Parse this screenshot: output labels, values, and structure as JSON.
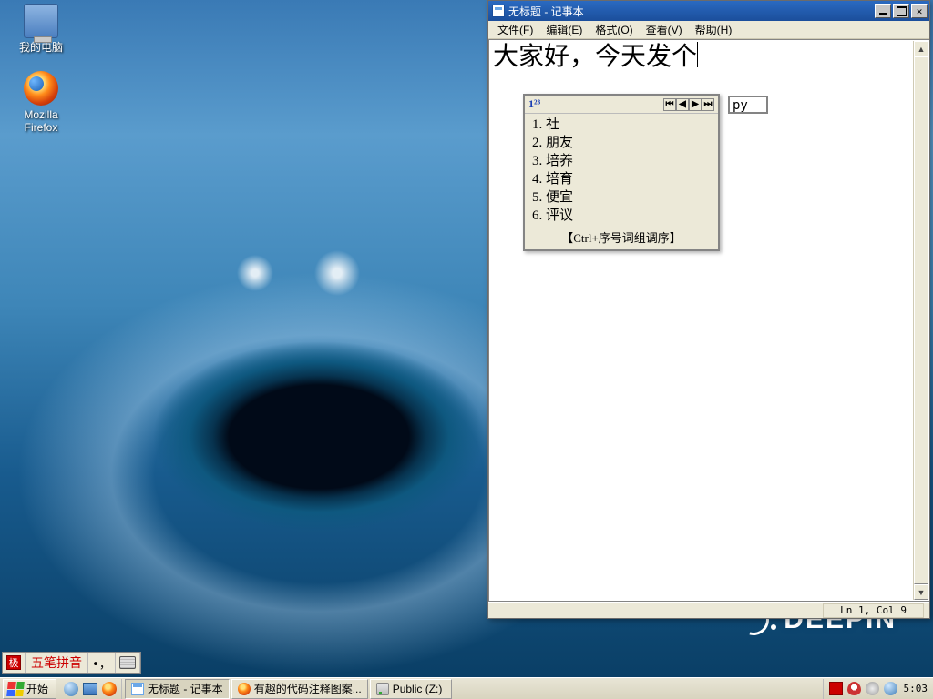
{
  "desktop": {
    "icons": [
      {
        "label": "我的电脑"
      },
      {
        "label": "Mozilla Firefox"
      }
    ],
    "brand": "DEEPIN"
  },
  "notepad": {
    "title": "无标题 - 记事本",
    "menu": {
      "file": "文件(F)",
      "edit": "编辑(E)",
      "format": "格式(O)",
      "view": "查看(V)",
      "help": "帮助(H)"
    },
    "content": "大家好，今天发个",
    "status": "Ln 1, Col 9"
  },
  "ime": {
    "composition": "py",
    "mode_indicator": "1²³",
    "candidates": [
      {
        "n": "1",
        "word": "社"
      },
      {
        "n": "2",
        "word": "朋友"
      },
      {
        "n": "3",
        "word": "培养"
      },
      {
        "n": "4",
        "word": "培育"
      },
      {
        "n": "5",
        "word": "便宜"
      },
      {
        "n": "6",
        "word": "评议"
      }
    ],
    "hint": "【Ctrl+序号词组调序】",
    "bar_name": "五笔拼音",
    "bar_punct": "•，"
  },
  "taskbar": {
    "start": "开始",
    "tasks": [
      {
        "label": "无标题 - 记事本",
        "icon": "notepad",
        "active": true
      },
      {
        "label": "有趣的代码注释图案...",
        "icon": "firefox",
        "active": false
      },
      {
        "label": "Public (Z:)",
        "icon": "drive",
        "active": false
      }
    ],
    "clock": "5:03"
  }
}
